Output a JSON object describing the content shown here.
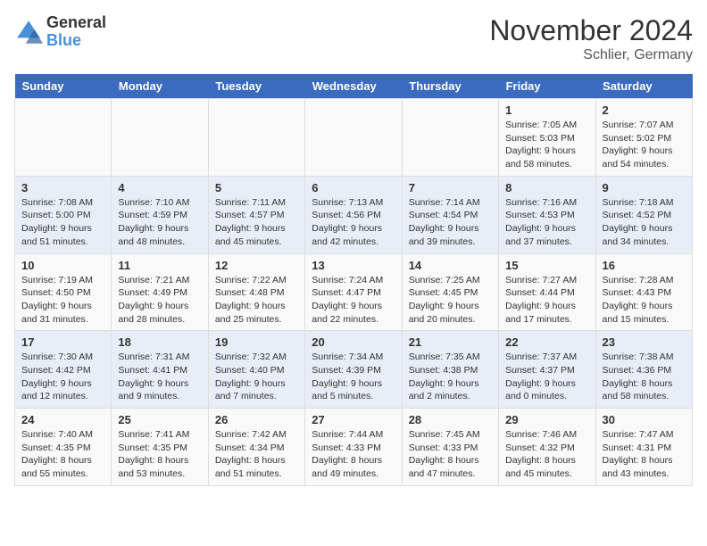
{
  "logo": {
    "general": "General",
    "blue": "Blue"
  },
  "title": "November 2024",
  "location": "Schlier, Germany",
  "weekdays": [
    "Sunday",
    "Monday",
    "Tuesday",
    "Wednesday",
    "Thursday",
    "Friday",
    "Saturday"
  ],
  "weeks": [
    [
      null,
      null,
      null,
      null,
      null,
      {
        "day": "1",
        "sunrise": "Sunrise: 7:05 AM",
        "sunset": "Sunset: 5:03 PM",
        "daylight": "Daylight: 9 hours and 58 minutes."
      },
      {
        "day": "2",
        "sunrise": "Sunrise: 7:07 AM",
        "sunset": "Sunset: 5:02 PM",
        "daylight": "Daylight: 9 hours and 54 minutes."
      }
    ],
    [
      {
        "day": "3",
        "sunrise": "Sunrise: 7:08 AM",
        "sunset": "Sunset: 5:00 PM",
        "daylight": "Daylight: 9 hours and 51 minutes."
      },
      {
        "day": "4",
        "sunrise": "Sunrise: 7:10 AM",
        "sunset": "Sunset: 4:59 PM",
        "daylight": "Daylight: 9 hours and 48 minutes."
      },
      {
        "day": "5",
        "sunrise": "Sunrise: 7:11 AM",
        "sunset": "Sunset: 4:57 PM",
        "daylight": "Daylight: 9 hours and 45 minutes."
      },
      {
        "day": "6",
        "sunrise": "Sunrise: 7:13 AM",
        "sunset": "Sunset: 4:56 PM",
        "daylight": "Daylight: 9 hours and 42 minutes."
      },
      {
        "day": "7",
        "sunrise": "Sunrise: 7:14 AM",
        "sunset": "Sunset: 4:54 PM",
        "daylight": "Daylight: 9 hours and 39 minutes."
      },
      {
        "day": "8",
        "sunrise": "Sunrise: 7:16 AM",
        "sunset": "Sunset: 4:53 PM",
        "daylight": "Daylight: 9 hours and 37 minutes."
      },
      {
        "day": "9",
        "sunrise": "Sunrise: 7:18 AM",
        "sunset": "Sunset: 4:52 PM",
        "daylight": "Daylight: 9 hours and 34 minutes."
      }
    ],
    [
      {
        "day": "10",
        "sunrise": "Sunrise: 7:19 AM",
        "sunset": "Sunset: 4:50 PM",
        "daylight": "Daylight: 9 hours and 31 minutes."
      },
      {
        "day": "11",
        "sunrise": "Sunrise: 7:21 AM",
        "sunset": "Sunset: 4:49 PM",
        "daylight": "Daylight: 9 hours and 28 minutes."
      },
      {
        "day": "12",
        "sunrise": "Sunrise: 7:22 AM",
        "sunset": "Sunset: 4:48 PM",
        "daylight": "Daylight: 9 hours and 25 minutes."
      },
      {
        "day": "13",
        "sunrise": "Sunrise: 7:24 AM",
        "sunset": "Sunset: 4:47 PM",
        "daylight": "Daylight: 9 hours and 22 minutes."
      },
      {
        "day": "14",
        "sunrise": "Sunrise: 7:25 AM",
        "sunset": "Sunset: 4:45 PM",
        "daylight": "Daylight: 9 hours and 20 minutes."
      },
      {
        "day": "15",
        "sunrise": "Sunrise: 7:27 AM",
        "sunset": "Sunset: 4:44 PM",
        "daylight": "Daylight: 9 hours and 17 minutes."
      },
      {
        "day": "16",
        "sunrise": "Sunrise: 7:28 AM",
        "sunset": "Sunset: 4:43 PM",
        "daylight": "Daylight: 9 hours and 15 minutes."
      }
    ],
    [
      {
        "day": "17",
        "sunrise": "Sunrise: 7:30 AM",
        "sunset": "Sunset: 4:42 PM",
        "daylight": "Daylight: 9 hours and 12 minutes."
      },
      {
        "day": "18",
        "sunrise": "Sunrise: 7:31 AM",
        "sunset": "Sunset: 4:41 PM",
        "daylight": "Daylight: 9 hours and 9 minutes."
      },
      {
        "day": "19",
        "sunrise": "Sunrise: 7:32 AM",
        "sunset": "Sunset: 4:40 PM",
        "daylight": "Daylight: 9 hours and 7 minutes."
      },
      {
        "day": "20",
        "sunrise": "Sunrise: 7:34 AM",
        "sunset": "Sunset: 4:39 PM",
        "daylight": "Daylight: 9 hours and 5 minutes."
      },
      {
        "day": "21",
        "sunrise": "Sunrise: 7:35 AM",
        "sunset": "Sunset: 4:38 PM",
        "daylight": "Daylight: 9 hours and 2 minutes."
      },
      {
        "day": "22",
        "sunrise": "Sunrise: 7:37 AM",
        "sunset": "Sunset: 4:37 PM",
        "daylight": "Daylight: 9 hours and 0 minutes."
      },
      {
        "day": "23",
        "sunrise": "Sunrise: 7:38 AM",
        "sunset": "Sunset: 4:36 PM",
        "daylight": "Daylight: 8 hours and 58 minutes."
      }
    ],
    [
      {
        "day": "24",
        "sunrise": "Sunrise: 7:40 AM",
        "sunset": "Sunset: 4:35 PM",
        "daylight": "Daylight: 8 hours and 55 minutes."
      },
      {
        "day": "25",
        "sunrise": "Sunrise: 7:41 AM",
        "sunset": "Sunset: 4:35 PM",
        "daylight": "Daylight: 8 hours and 53 minutes."
      },
      {
        "day": "26",
        "sunrise": "Sunrise: 7:42 AM",
        "sunset": "Sunset: 4:34 PM",
        "daylight": "Daylight: 8 hours and 51 minutes."
      },
      {
        "day": "27",
        "sunrise": "Sunrise: 7:44 AM",
        "sunset": "Sunset: 4:33 PM",
        "daylight": "Daylight: 8 hours and 49 minutes."
      },
      {
        "day": "28",
        "sunrise": "Sunrise: 7:45 AM",
        "sunset": "Sunset: 4:33 PM",
        "daylight": "Daylight: 8 hours and 47 minutes."
      },
      {
        "day": "29",
        "sunrise": "Sunrise: 7:46 AM",
        "sunset": "Sunset: 4:32 PM",
        "daylight": "Daylight: 8 hours and 45 minutes."
      },
      {
        "day": "30",
        "sunrise": "Sunrise: 7:47 AM",
        "sunset": "Sunset: 4:31 PM",
        "daylight": "Daylight: 8 hours and 43 minutes."
      }
    ]
  ]
}
